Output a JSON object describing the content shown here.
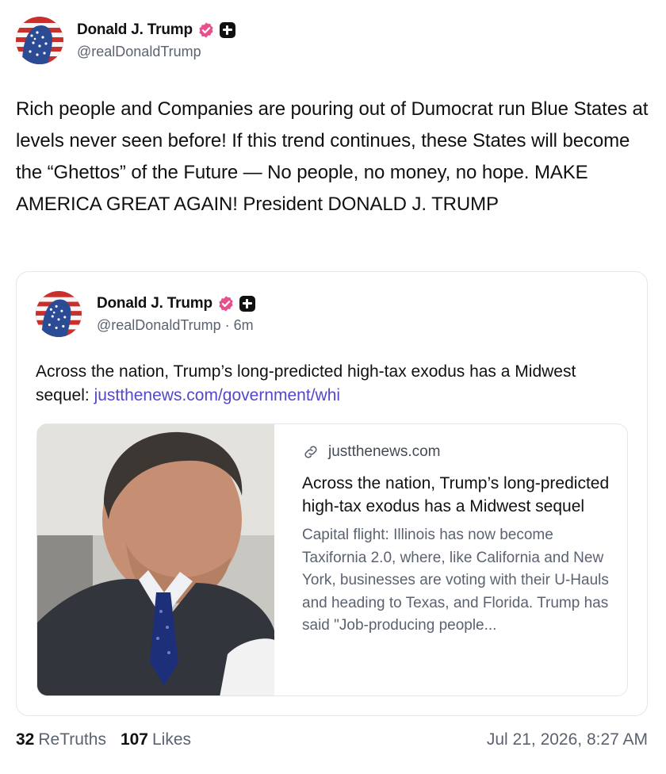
{
  "post": {
    "author": {
      "display_name": "Donald J. Trump",
      "handle": "@realDonaldTrump",
      "avatar_icon": "flag-portrait-avatar",
      "verified_icon": "verified-badge-icon",
      "verified_color": "#e8508d",
      "extra_badge_icon": "plus-badge-icon"
    },
    "text": "Rich people and Companies are pouring out of Dumocrat run Blue States at levels never seen before! If this trend continues, these States will become the “Ghettos” of the Future — No people, no money, no hope. MAKE AMERICA GREAT AGAIN! President DONALD J. TRUMP"
  },
  "quote": {
    "author": {
      "display_name": "Donald J. Trump",
      "handle": "@realDonaldTrump",
      "separator": "·",
      "time_ago": "6m"
    },
    "text": "Across the nation, Trump’s long-predicted high-tax exodus has a Midwest sequel:",
    "link_text": "justthenews.com/government/whi",
    "link_color": "#5448c8",
    "preview": {
      "domain_icon": "link-icon",
      "domain": "justthenews.com",
      "title": "Across the nation, Trump’s long-predicted high-tax exodus has a Midwest sequel",
      "description": "Capital flight: Illinois has now become Taxifornia 2.0, where, like California and New York, businesses are voting with their U-Hauls and heading to Texas, and Florida. Trump has said \"Job-producing people..."
    }
  },
  "stats": {
    "retruths_count": "32",
    "retruths_label": "ReTruths",
    "likes_count": "107",
    "likes_label": "Likes",
    "timestamp": "Jul 21, 2026, 8:27 AM"
  }
}
